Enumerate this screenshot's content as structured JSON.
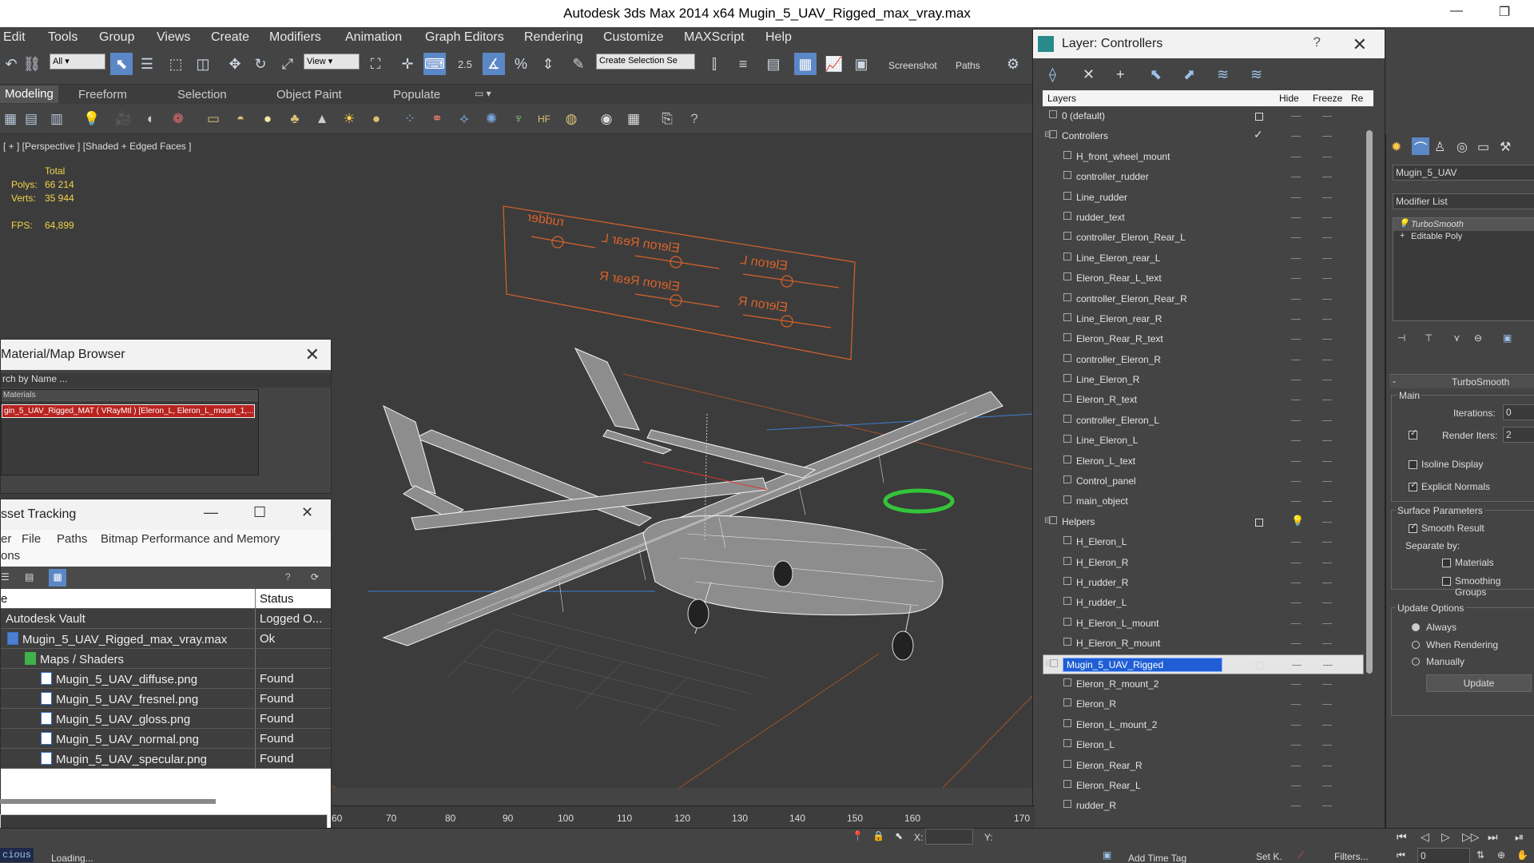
{
  "window": {
    "title": "Autodesk 3ds Max  2014 x64      Mugin_5_UAV_Rigged_max_vray.max",
    "minimize": "—",
    "restore": "❐"
  },
  "menu": [
    "Edit",
    "Tools",
    "Group",
    "Views",
    "Create",
    "Modifiers",
    "Animation",
    "Graph Editors",
    "Rendering",
    "Customize",
    "MAXScript",
    "Help"
  ],
  "toolbar": {
    "selection_filter": "All",
    "ref_coord": "View",
    "named_selection": "Create Selection Se",
    "screenshot_label": "Screenshot",
    "paths_label": "Paths",
    "snap_angle": "2.5"
  },
  "ribbon": {
    "tabs": [
      "Modeling",
      "Freeform",
      "Selection",
      "Object Paint",
      "Populate"
    ],
    "active": "Modeling"
  },
  "viewport": {
    "label": "[ + ] [Perspective ] [Shaded + Edged Faces ]",
    "stats": {
      "total_label": "Total",
      "polys_label": "Polys:",
      "polys": "66 214",
      "verts_label": "Verts:",
      "verts": "35 944",
      "fps_label": "FPS:",
      "fps": "64,899"
    },
    "control_panel_labels": [
      "rudder",
      "Eleron Rear L",
      "Eleron L",
      "Eleron Rear R",
      "Eleron R"
    ]
  },
  "material_browser": {
    "title": "Material/Map Browser",
    "search_placeholder": "rch by Name ...",
    "list_header": "Materials",
    "selected_item": "gin_5_UAV_Rigged_MAT ( VRayMtl ) [Eleron_L, Eleron_L_mount_1,..."
  },
  "asset_tracking": {
    "title": "sset Tracking",
    "menu": [
      "er",
      "File",
      "Paths",
      "Bitmap Performance and Memory"
    ],
    "options_label": "ons",
    "col_name": "e",
    "col_status": "Status",
    "rows": [
      {
        "name": "Autodesk Vault",
        "status": "Logged O..."
      },
      {
        "name": "Mugin_5_UAV_Rigged_max_vray.max",
        "status": "Ok"
      },
      {
        "name": "Maps / Shaders",
        "status": ""
      },
      {
        "name": "Mugin_5_UAV_diffuse.png",
        "status": "Found"
      },
      {
        "name": "Mugin_5_UAV_fresnel.png",
        "status": "Found"
      },
      {
        "name": "Mugin_5_UAV_gloss.png",
        "status": "Found"
      },
      {
        "name": "Mugin_5_UAV_normal.png",
        "status": "Found"
      },
      {
        "name": "Mugin_5_UAV_specular.png",
        "status": "Found"
      }
    ]
  },
  "layer_dialog": {
    "title": "Layer: Controllers",
    "help": "?",
    "col_layers": "Layers",
    "col_hide": "Hide",
    "col_freeze": "Freeze",
    "col_render": "Re",
    "rows": [
      {
        "name": "0 (default)",
        "level": 0,
        "type": "layer"
      },
      {
        "name": "Controllers",
        "level": 0,
        "type": "layer",
        "current": true
      },
      {
        "name": "H_front_wheel_mount",
        "level": 1
      },
      {
        "name": "controller_rudder",
        "level": 1
      },
      {
        "name": "Line_rudder",
        "level": 1
      },
      {
        "name": "rudder_text",
        "level": 1
      },
      {
        "name": "controller_Eleron_Rear_L",
        "level": 1
      },
      {
        "name": "Line_Eleron_rear_L",
        "level": 1
      },
      {
        "name": "Eleron_Rear_L_text",
        "level": 1
      },
      {
        "name": "controller_Eleron_Rear_R",
        "level": 1
      },
      {
        "name": "Line_Eleron_rear_R",
        "level": 1
      },
      {
        "name": "Eleron_Rear_R_text",
        "level": 1
      },
      {
        "name": "controller_Eleron_R",
        "level": 1
      },
      {
        "name": "Line_Eleron_R",
        "level": 1
      },
      {
        "name": "Eleron_R_text",
        "level": 1
      },
      {
        "name": "controller_Eleron_L",
        "level": 1
      },
      {
        "name": "Line_Eleron_L",
        "level": 1
      },
      {
        "name": "Eleron_L_text",
        "level": 1
      },
      {
        "name": "Control_panel",
        "level": 1
      },
      {
        "name": "main_object",
        "level": 1
      },
      {
        "name": "Helpers",
        "level": 0,
        "type": "layer",
        "hidden": true
      },
      {
        "name": "H_Eleron_L",
        "level": 1
      },
      {
        "name": "H_Eleron_R",
        "level": 1
      },
      {
        "name": "H_rudder_R",
        "level": 1
      },
      {
        "name": "H_rudder_L",
        "level": 1
      },
      {
        "name": "H_Eleron_L_mount",
        "level": 1
      },
      {
        "name": "H_Eleron_R_mount",
        "level": 1
      },
      {
        "name": "Mugin_5_UAV_Rigged",
        "level": 0,
        "type": "layer",
        "selected": true
      },
      {
        "name": "Eleron_R_mount_2",
        "level": 1
      },
      {
        "name": "Eleron_R",
        "level": 1
      },
      {
        "name": "Eleron_L_mount_2",
        "level": 1
      },
      {
        "name": "Eleron_L",
        "level": 1
      },
      {
        "name": "Eleron_Rear_R",
        "level": 1
      },
      {
        "name": "Eleron_Rear_L",
        "level": 1
      },
      {
        "name": "rudder_R",
        "level": 1
      }
    ]
  },
  "command_panel": {
    "object_name": "Mugin_5_UAV",
    "modifier_list": "Modifier List",
    "stack": [
      "TurboSmooth",
      "Editable Poly"
    ],
    "rollout_title": "TurboSmooth",
    "main_label": "Main",
    "iterations_label": "Iterations:",
    "iterations": "0",
    "render_iters_label": "Render Iters:",
    "render_iters": "2",
    "isoline_label": "Isoline Display",
    "explicit_normals_label": "Explicit Normals",
    "surface_label": "Surface Parameters",
    "smooth_result_label": "Smooth Result",
    "separate_label": "Separate by:",
    "materials_label": "Materials",
    "smoothing_groups_label": "Smoothing Groups",
    "update_options_label": "Update Options",
    "always_label": "Always",
    "when_rendering_label": "When Rendering",
    "manually_label": "Manually",
    "update_button": "Update"
  },
  "timeline": {
    "ticks": [
      "60",
      "70",
      "80",
      "90",
      "100",
      "110",
      "120",
      "130",
      "140",
      "150",
      "160",
      "170"
    ]
  },
  "status": {
    "script_label": "cious",
    "loading": "Loading...",
    "x_label": "X:",
    "y_label": "Y:",
    "add_time_tag": "Add Time Tag",
    "set_key": "Set K.",
    "filters": "Filters...",
    "frame": "0"
  },
  "colors": {
    "accent": "#1f5ed4",
    "viewport_bg": "#3c3c3c",
    "control_orange": "#d9622b",
    "stats_yellow": "#f1d34a"
  }
}
